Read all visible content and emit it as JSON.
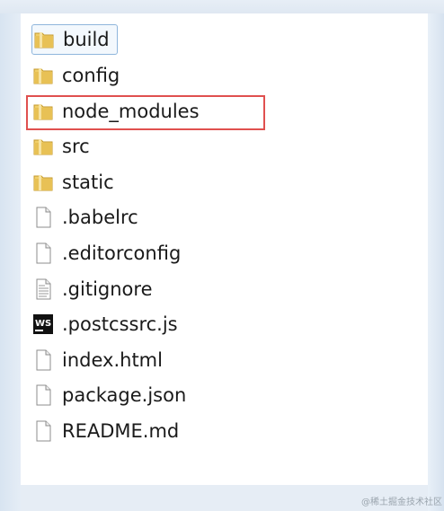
{
  "files": [
    {
      "name": "build",
      "icon": "folder-icon"
    },
    {
      "name": "config",
      "icon": "folder-icon"
    },
    {
      "name": "node_modules",
      "icon": "folder-icon"
    },
    {
      "name": "src",
      "icon": "folder-icon"
    },
    {
      "name": "static",
      "icon": "folder-icon"
    },
    {
      "name": ".babelrc",
      "icon": "file-icon"
    },
    {
      "name": ".editorconfig",
      "icon": "file-icon"
    },
    {
      "name": ".gitignore",
      "icon": "text-file-icon"
    },
    {
      "name": ".postcssrc.js",
      "icon": "webstorm-file-icon"
    },
    {
      "name": "index.html",
      "icon": "file-icon"
    },
    {
      "name": "package.json",
      "icon": "file-icon"
    },
    {
      "name": "README.md",
      "icon": "file-icon"
    }
  ],
  "focused_item": "build",
  "highlighted_item": "node_modules",
  "webstorm_icon_text": "WS",
  "watermark": "@稀土掘金技术社区",
  "colors": {
    "highlight_border": "#e0504f",
    "focus_border": "#8fb6dc",
    "folder": "#e8c155"
  }
}
